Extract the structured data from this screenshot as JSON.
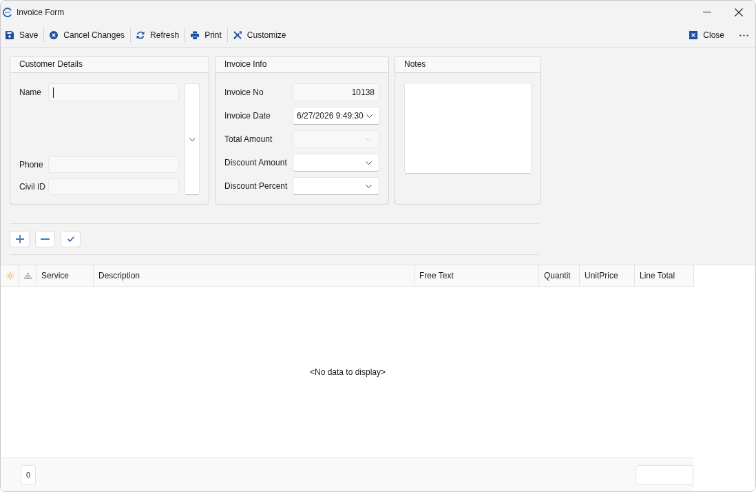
{
  "window": {
    "title": "Invoice Form"
  },
  "toolbar": {
    "items": [
      {
        "kind": "save",
        "label": "Save"
      },
      {
        "kind": "cancel",
        "label": "Cancel Changes"
      },
      {
        "kind": "refresh",
        "label": "Refresh"
      },
      {
        "kind": "print",
        "label": "Print"
      },
      {
        "kind": "customize",
        "label": "Customize"
      }
    ],
    "right_items": [
      {
        "kind": "close",
        "label": "Close"
      }
    ]
  },
  "customer_details": {
    "title": "Customer Details",
    "fields": [
      {
        "label": "Name",
        "focused": true
      },
      {
        "label": "Phone",
        "focused": false
      },
      {
        "label": "Civil ID",
        "focused": false
      }
    ]
  },
  "invoice_info": {
    "title": "Invoice Info",
    "fields": [
      {
        "label": "Invoice No",
        "kind": "text",
        "value": "10138",
        "disabled": false
      },
      {
        "label": "Invoice Date",
        "kind": "dropdown",
        "value": "6/27/2026 9:49:30",
        "disabled": false
      },
      {
        "label": "Total Amount",
        "kind": "dropdown",
        "disabled": true
      },
      {
        "label": "Discount Amount",
        "kind": "dropdown",
        "disabled": false
      },
      {
        "label": "Discount Percent",
        "kind": "dropdown",
        "disabled": false
      }
    ]
  },
  "notes": {
    "title": "Notes"
  },
  "line_actions": [
    {
      "kind": "add"
    },
    {
      "kind": "remove"
    },
    {
      "kind": "confirm"
    }
  ],
  "grid": {
    "columns": [
      {
        "kind": "indicator"
      },
      {
        "kind": "sort"
      },
      {
        "kind": "text",
        "label": "Service"
      },
      {
        "kind": "text",
        "label": "Description"
      },
      {
        "kind": "text",
        "label": "Free Text"
      },
      {
        "kind": "text",
        "label": "Quantit"
      },
      {
        "kind": "text",
        "label": "UnitPrice"
      },
      {
        "kind": "text",
        "label": "Line Total"
      }
    ],
    "empty_text": "<No data to display>",
    "footer": {
      "count": "0"
    }
  }
}
